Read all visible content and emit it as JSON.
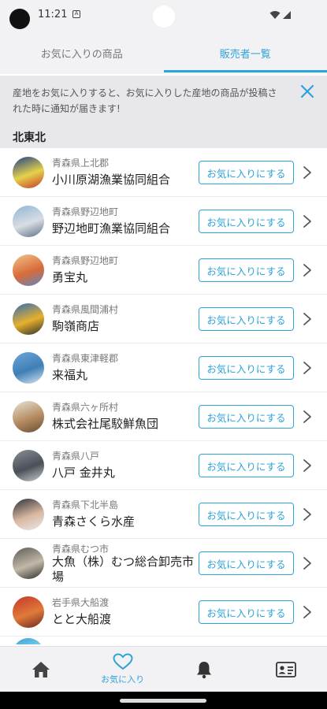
{
  "status": {
    "time": "11:21",
    "notification_glyph": "A"
  },
  "tabs": [
    {
      "label": "お気に入りの商品",
      "active": false
    },
    {
      "label": "販売者一覧",
      "active": true
    }
  ],
  "banner": {
    "text": "産地をお気に入りすると、お気に入りした産地の商品が投稿された時に通知が届きます!",
    "close_icon": "close-icon"
  },
  "section": {
    "title": "北東北"
  },
  "sellers": [
    {
      "region": "青森県上北郡",
      "name": "小川原湖漁業協同組合",
      "button": "お気に入りにする",
      "avatar_colors": [
        "#1b3f8a",
        "#e6d24a",
        "#c33a2a"
      ]
    },
    {
      "region": "青森県野辺地町",
      "name": "野辺地町漁業協同組合",
      "button": "お気に入りにする",
      "avatar_colors": [
        "#8fb5d6",
        "#d9dde3",
        "#5a6e86"
      ]
    },
    {
      "region": "青森県野辺地町",
      "name": "勇宝丸",
      "button": "お気に入りにする",
      "avatar_colors": [
        "#f2c48a",
        "#d96a3a",
        "#5a88c2"
      ]
    },
    {
      "region": "青森県風間浦村",
      "name": "駒嶺商店",
      "button": "お気に入りにする",
      "avatar_colors": [
        "#2d6db5",
        "#e7b02d",
        "#2c2c2c"
      ]
    },
    {
      "region": "青森県東津軽郡",
      "name": "来福丸",
      "button": "お気に入りにする",
      "avatar_colors": [
        "#6fa6d9",
        "#3f7fb5",
        "#d8e6f2"
      ]
    },
    {
      "region": "青森県六ヶ所村",
      "name": "株式会社尾駮鮮魚団",
      "button": "お気に入りにする",
      "avatar_colors": [
        "#e9e2d6",
        "#b58d62",
        "#6a4d33"
      ]
    },
    {
      "region": "青森県八戸",
      "name": "八戸 金井丸",
      "button": "お気に入りにする",
      "avatar_colors": [
        "#8a8f96",
        "#4b5058",
        "#c9ccd0"
      ]
    },
    {
      "region": "青森県下北半島",
      "name": "青森さくら水産",
      "button": "お気に入りにする",
      "avatar_colors": [
        "#2b2f3a",
        "#d9b8a0",
        "#e8e8ea"
      ]
    },
    {
      "region": "青森県むつ市",
      "name": "大魚（株）むつ総合卸売市場",
      "button": "お気に入りにする",
      "avatar_colors": [
        "#5d5a55",
        "#c2b9a8",
        "#2f2d2a"
      ]
    },
    {
      "region": "岩手県大船渡",
      "name": "とと大船渡",
      "button": "お気に入りにする",
      "avatar_colors": [
        "#c23a28",
        "#e07a3a",
        "#6a2a1e"
      ]
    }
  ],
  "peek_seller": {
    "avatar_colors": [
      "#2ea3d8",
      "#9ad0ea",
      "#2ea3d8"
    ]
  },
  "bottom_nav": [
    {
      "label": "",
      "icon": "home-icon",
      "active": false
    },
    {
      "label": "お気に入り",
      "icon": "heart-icon",
      "active": true
    },
    {
      "label": "",
      "icon": "bell-icon",
      "active": false
    },
    {
      "label": "",
      "icon": "id-card-icon",
      "active": false
    }
  ],
  "colors": {
    "accent": "#2ea3d8",
    "banner_bg": "#e8e8ec",
    "bar_bg": "#f2f2f4"
  }
}
